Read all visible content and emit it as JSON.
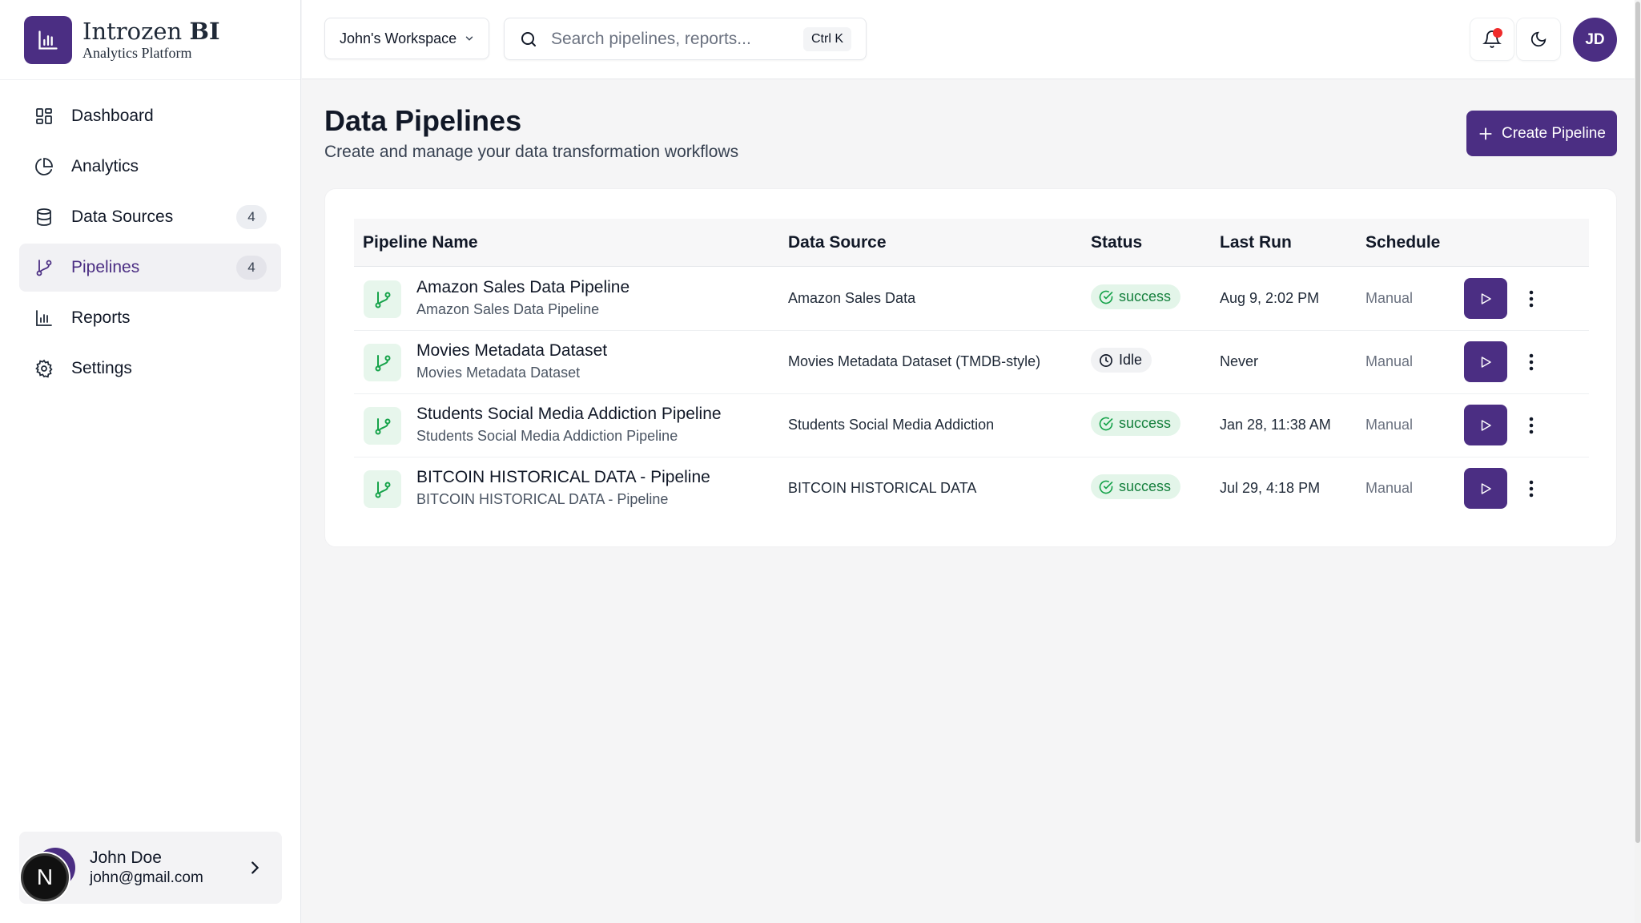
{
  "brand": {
    "name": "Introzen",
    "name_bold": "BI",
    "subtitle": "Analytics Platform"
  },
  "sidebar": {
    "items": [
      {
        "label": "Dashboard",
        "icon": "dashboard-grid-icon",
        "badge": ""
      },
      {
        "label": "Analytics",
        "icon": "pie-chart-icon",
        "badge": ""
      },
      {
        "label": "Data Sources",
        "icon": "database-icon",
        "badge": "4"
      },
      {
        "label": "Pipelines",
        "icon": "git-branch-icon",
        "badge": "4",
        "active": true
      },
      {
        "label": "Reports",
        "icon": "bar-chart-icon",
        "badge": ""
      },
      {
        "label": "Settings",
        "icon": "gear-icon",
        "badge": ""
      }
    ],
    "user": {
      "name": "John Doe",
      "email": "john@gmail.com"
    },
    "n_badge": "N"
  },
  "topbar": {
    "workspace": "John's Workspace",
    "search_placeholder": "Search pipelines, reports...",
    "shortcut": "Ctrl K",
    "avatar_initials": "JD"
  },
  "page": {
    "title": "Data Pipelines",
    "subtitle": "Create and manage your data transformation workflows",
    "create_label": "Create Pipeline"
  },
  "table": {
    "headers": [
      "Pipeline Name",
      "Data Source",
      "Status",
      "Last Run",
      "Schedule"
    ],
    "rows": [
      {
        "name": "Amazon Sales Data Pipeline",
        "desc": "Amazon Sales Data Pipeline",
        "source": "Amazon Sales Data",
        "status": "success",
        "last_run": "Aug 9, 2:02 PM",
        "schedule": "Manual"
      },
      {
        "name": "Movies Metadata Dataset",
        "desc": "Movies Metadata Dataset",
        "source": "Movies Metadata Dataset (TMDB-style)",
        "status": "Idle",
        "last_run": "Never",
        "schedule": "Manual"
      },
      {
        "name": "Students Social Media Addiction Pipeline",
        "desc": "Students Social Media Addiction Pipeline",
        "source": "Students Social Media Addiction",
        "status": "success",
        "last_run": "Jan 28, 11:38 AM",
        "schedule": "Manual"
      },
      {
        "name": "BITCOIN HISTORICAL DATA - Pipeline",
        "desc": "BITCOIN HISTORICAL DATA - Pipeline",
        "source": "BITCOIN HISTORICAL DATA",
        "status": "success",
        "last_run": "Jul 29, 4:18 PM",
        "schedule": "Manual"
      }
    ]
  },
  "colors": {
    "accent": "#4b2e83",
    "success_bg": "#e3f5e9",
    "success_text": "#15803d",
    "notification": "#ef2b2b"
  }
}
